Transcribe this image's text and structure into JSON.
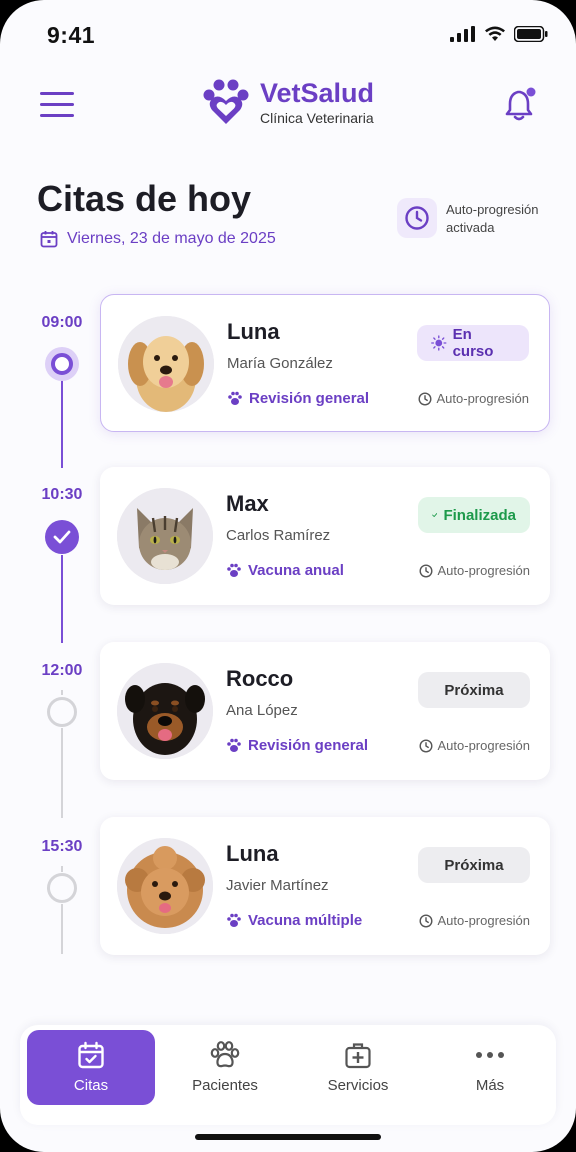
{
  "status": {
    "time": "9:41"
  },
  "brand": {
    "name": "VetSalud",
    "subtitle": "Clínica Veterinaria"
  },
  "header": {
    "title": "Citas de hoy",
    "date": "Viernes, 23 de mayo de 2025",
    "auto_progress": "Auto-progresión activada"
  },
  "appointments": [
    {
      "time": "09:00",
      "pet": "Luna",
      "owner": "María González",
      "service": "Revisión general",
      "status": "En curso",
      "auto": "Auto-progresión",
      "animal": "golden retriever"
    },
    {
      "time": "10:30",
      "pet": "Max",
      "owner": "Carlos Ramírez",
      "service": "Vacuna anual",
      "status": "Finalizada",
      "auto": "Auto-progresión",
      "animal": "tabby cat"
    },
    {
      "time": "12:00",
      "pet": "Rocco",
      "owner": "Ana López",
      "service": "Revisión general",
      "status": "Próxima",
      "auto": "Auto-progresión",
      "animal": "rottweiler"
    },
    {
      "time": "15:30",
      "pet": "Luna",
      "owner": "Javier Martínez",
      "service": "Vacuna múltiple",
      "status": "Próxima",
      "auto": "Auto-progresión",
      "animal": "goldendoodle"
    }
  ],
  "nav": [
    {
      "label": "Citas",
      "icon": "calendar-check-icon",
      "active": true
    },
    {
      "label": "Pacientes",
      "icon": "paw-icon"
    },
    {
      "label": "Servicios",
      "icon": "medical-kit-icon"
    },
    {
      "label": "Más",
      "icon": "more-dots-icon"
    }
  ],
  "colors": {
    "primary": "#6b3fc4",
    "success": "#1d9a4b",
    "background": "#fbfbfe"
  }
}
